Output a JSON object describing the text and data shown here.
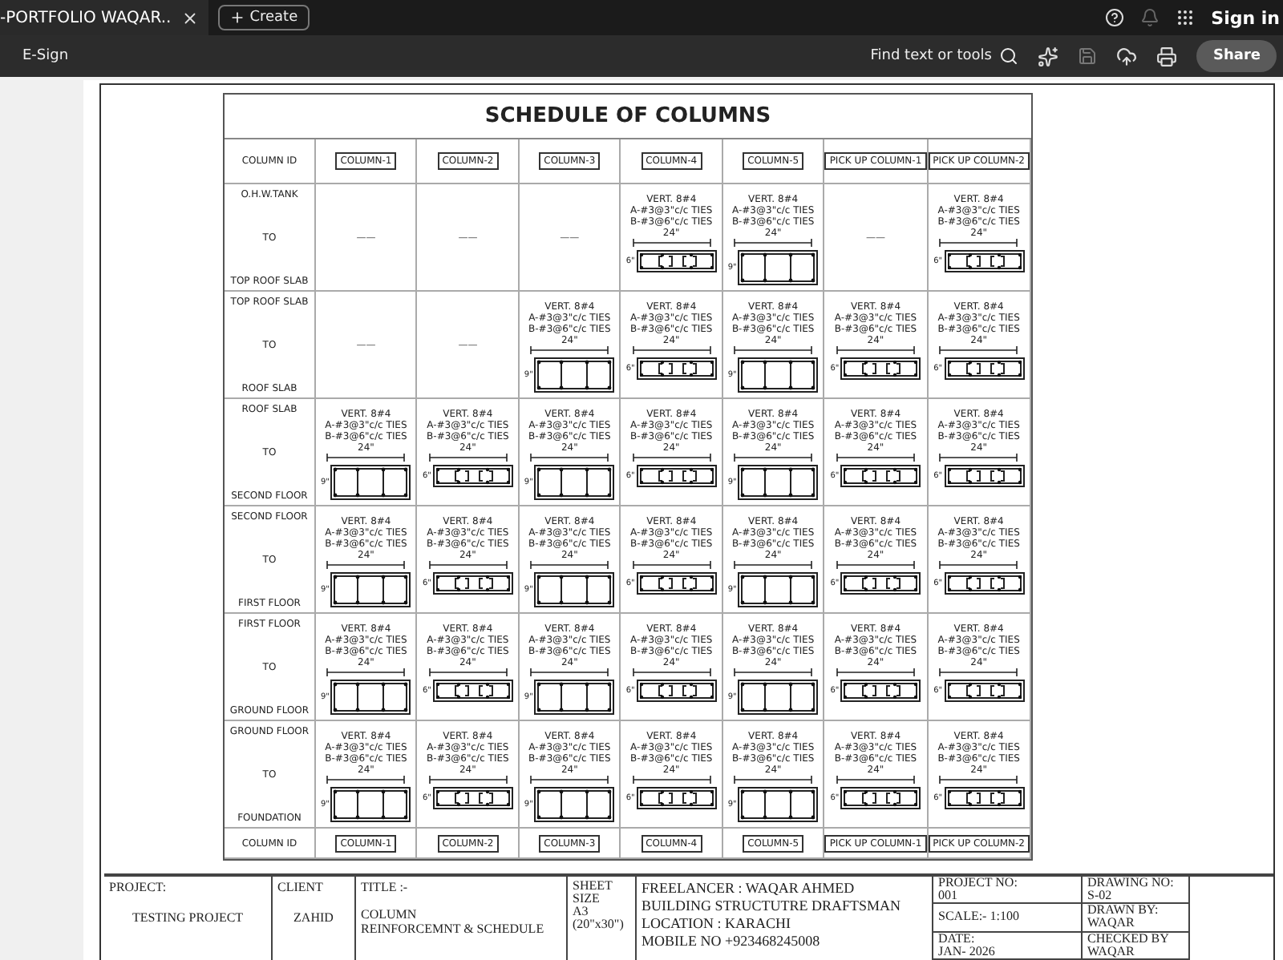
{
  "app_bar": {
    "tab_title": "-PORTFOLIO WAQAR..",
    "create": "Create",
    "sign_in": "Sign in"
  },
  "toolbar": {
    "esign": "E-Sign",
    "find": "Find text or tools",
    "share": "Share"
  },
  "schedule": {
    "title": "SCHEDULE OF COLUMNS",
    "id_label": "COLUMN ID",
    "columns": [
      "COLUMN-1",
      "COLUMN-2",
      "COLUMN-3",
      "COLUMN-4",
      "COLUMN-5",
      "PICK UP COLUMN-1",
      "PICK UP COLUMN-2"
    ],
    "rows": [
      {
        "from": "O.H.W.TANK",
        "mid": "TO",
        "to": "TOP ROOF SLAB",
        "cells": [
          {
            "kind": "empty",
            "text": "——"
          },
          {
            "kind": "empty",
            "text": "——"
          },
          {
            "kind": "empty",
            "text": "——"
          },
          {
            "kind": "thin",
            "vert": "VERT. 8#4",
            "tie_a": "A-#3@3\"c/c TIES",
            "tie_b": "B-#3@6\"c/c TIES",
            "width": "24\"",
            "depth": "6\""
          },
          {
            "kind": "tall",
            "vert": "VERT. 8#4",
            "tie_a": "A-#3@3\"c/c TIES",
            "tie_b": "B-#3@6\"c/c TIES",
            "width": "24\"",
            "depth": "9\""
          },
          {
            "kind": "empty",
            "text": "——"
          },
          {
            "kind": "thin",
            "vert": "VERT. 8#4",
            "tie_a": "A-#3@3\"c/c TIES",
            "tie_b": "B-#3@6\"c/c TIES",
            "width": "24\"",
            "depth": "6\""
          }
        ]
      },
      {
        "from": "TOP ROOF SLAB",
        "mid": "TO",
        "to": "ROOF SLAB",
        "cells": [
          {
            "kind": "empty",
            "text": "——"
          },
          {
            "kind": "empty",
            "text": "——"
          },
          {
            "kind": "tall",
            "vert": "VERT. 8#4",
            "tie_a": "A-#3@3\"c/c TIES",
            "tie_b": "B-#3@6\"c/c TIES",
            "width": "24\"",
            "depth": "9\""
          },
          {
            "kind": "thin",
            "vert": "VERT. 8#4",
            "tie_a": "A-#3@3\"c/c TIES",
            "tie_b": "B-#3@6\"c/c TIES",
            "width": "24\"",
            "depth": "6\""
          },
          {
            "kind": "tall",
            "vert": "VERT. 8#4",
            "tie_a": "A-#3@3\"c/c TIES",
            "tie_b": "B-#3@6\"c/c TIES",
            "width": "24\"",
            "depth": "9\""
          },
          {
            "kind": "thin",
            "vert": "VERT. 8#4",
            "tie_a": "A-#3@3\"c/c TIES",
            "tie_b": "B-#3@6\"c/c TIES",
            "width": "24\"",
            "depth": "6\""
          },
          {
            "kind": "thin",
            "vert": "VERT. 8#4",
            "tie_a": "A-#3@3\"c/c TIES",
            "tie_b": "B-#3@6\"c/c TIES",
            "width": "24\"",
            "depth": "6\""
          }
        ]
      },
      {
        "from": "ROOF SLAB",
        "mid": "TO",
        "to": "SECOND FLOOR",
        "cells": [
          {
            "kind": "tall",
            "vert": "VERT. 8#4",
            "tie_a": "A-#3@3\"c/c TIES",
            "tie_b": "B-#3@6\"c/c TIES",
            "width": "24\"",
            "depth": "9\""
          },
          {
            "kind": "thin",
            "vert": "VERT. 8#4",
            "tie_a": "A-#3@3\"c/c TIES",
            "tie_b": "B-#3@6\"c/c TIES",
            "width": "24\"",
            "depth": "6\""
          },
          {
            "kind": "tall",
            "vert": "VERT. 8#4",
            "tie_a": "A-#3@3\"c/c TIES",
            "tie_b": "B-#3@6\"c/c TIES",
            "width": "24\"",
            "depth": "9\""
          },
          {
            "kind": "thin",
            "vert": "VERT. 8#4",
            "tie_a": "A-#3@3\"c/c TIES",
            "tie_b": "B-#3@6\"c/c TIES",
            "width": "24\"",
            "depth": "6\""
          },
          {
            "kind": "tall",
            "vert": "VERT. 8#4",
            "tie_a": "A-#3@3\"c/c TIES",
            "tie_b": "B-#3@6\"c/c TIES",
            "width": "24\"",
            "depth": "9\""
          },
          {
            "kind": "thin",
            "vert": "VERT. 8#4",
            "tie_a": "A-#3@3\"c/c TIES",
            "tie_b": "B-#3@6\"c/c TIES",
            "width": "24\"",
            "depth": "6\""
          },
          {
            "kind": "thin",
            "vert": "VERT. 8#4",
            "tie_a": "A-#3@3\"c/c TIES",
            "tie_b": "B-#3@6\"c/c TIES",
            "width": "24\"",
            "depth": "6\""
          }
        ]
      },
      {
        "from": "SECOND FLOOR",
        "mid": "TO",
        "to": "FIRST FLOOR",
        "cells": [
          {
            "kind": "tall",
            "vert": "VERT. 8#4",
            "tie_a": "A-#3@3\"c/c TIES",
            "tie_b": "B-#3@6\"c/c TIES",
            "width": "24\"",
            "depth": "9\""
          },
          {
            "kind": "thin",
            "vert": "VERT. 8#4",
            "tie_a": "A-#3@3\"c/c TIES",
            "tie_b": "B-#3@6\"c/c TIES",
            "width": "24\"",
            "depth": "6\""
          },
          {
            "kind": "tall",
            "vert": "VERT. 8#4",
            "tie_a": "A-#3@3\"c/c TIES",
            "tie_b": "B-#3@6\"c/c TIES",
            "width": "24\"",
            "depth": "9\""
          },
          {
            "kind": "thin",
            "vert": "VERT. 8#4",
            "tie_a": "A-#3@3\"c/c TIES",
            "tie_b": "B-#3@6\"c/c TIES",
            "width": "24\"",
            "depth": "6\""
          },
          {
            "kind": "tall",
            "vert": "VERT. 8#4",
            "tie_a": "A-#3@3\"c/c TIES",
            "tie_b": "B-#3@6\"c/c TIES",
            "width": "24\"",
            "depth": "9\""
          },
          {
            "kind": "thin",
            "vert": "VERT. 8#4",
            "tie_a": "A-#3@3\"c/c TIES",
            "tie_b": "B-#3@6\"c/c TIES",
            "width": "24\"",
            "depth": "6\""
          },
          {
            "kind": "thin",
            "vert": "VERT. 8#4",
            "tie_a": "A-#3@3\"c/c TIES",
            "tie_b": "B-#3@6\"c/c TIES",
            "width": "24\"",
            "depth": "6\""
          }
        ]
      },
      {
        "from": "FIRST FLOOR",
        "mid": "TO",
        "to": "GROUND FLOOR",
        "cells": [
          {
            "kind": "tall",
            "vert": "VERT. 8#4",
            "tie_a": "A-#3@3\"c/c TIES",
            "tie_b": "B-#3@6\"c/c TIES",
            "width": "24\"",
            "depth": "9\""
          },
          {
            "kind": "thin",
            "vert": "VERT. 8#4",
            "tie_a": "A-#3@3\"c/c TIES",
            "tie_b": "B-#3@6\"c/c TIES",
            "width": "24\"",
            "depth": "6\""
          },
          {
            "kind": "tall",
            "vert": "VERT. 8#4",
            "tie_a": "A-#3@3\"c/c TIES",
            "tie_b": "B-#3@6\"c/c TIES",
            "width": "24\"",
            "depth": "9\""
          },
          {
            "kind": "thin",
            "vert": "VERT. 8#4",
            "tie_a": "A-#3@3\"c/c TIES",
            "tie_b": "B-#3@6\"c/c TIES",
            "width": "24\"",
            "depth": "6\""
          },
          {
            "kind": "tall",
            "vert": "VERT. 8#4",
            "tie_a": "A-#3@3\"c/c TIES",
            "tie_b": "B-#3@6\"c/c TIES",
            "width": "24\"",
            "depth": "9\""
          },
          {
            "kind": "thin",
            "vert": "VERT. 8#4",
            "tie_a": "A-#3@3\"c/c TIES",
            "tie_b": "B-#3@6\"c/c TIES",
            "width": "24\"",
            "depth": "6\""
          },
          {
            "kind": "thin",
            "vert": "VERT. 8#4",
            "tie_a": "A-#3@3\"c/c TIES",
            "tie_b": "B-#3@6\"c/c TIES",
            "width": "24\"",
            "depth": "6\""
          }
        ]
      },
      {
        "from": "GROUND FLOOR",
        "mid": "TO",
        "to": "FOUNDATION",
        "cells": [
          {
            "kind": "tall",
            "vert": "VERT. 8#4",
            "tie_a": "A-#3@3\"c/c TIES",
            "tie_b": "B-#3@6\"c/c TIES",
            "width": "24\"",
            "depth": "9\""
          },
          {
            "kind": "thin",
            "vert": "VERT. 8#4",
            "tie_a": "A-#3@3\"c/c TIES",
            "tie_b": "B-#3@6\"c/c TIES",
            "width": "24\"",
            "depth": "6\""
          },
          {
            "kind": "tall",
            "vert": "VERT. 8#4",
            "tie_a": "A-#3@3\"c/c TIES",
            "tie_b": "B-#3@6\"c/c TIES",
            "width": "24\"",
            "depth": "9\""
          },
          {
            "kind": "thin",
            "vert": "VERT. 8#4",
            "tie_a": "A-#3@3\"c/c TIES",
            "tie_b": "B-#3@6\"c/c TIES",
            "width": "24\"",
            "depth": "6\""
          },
          {
            "kind": "tall",
            "vert": "VERT. 8#4",
            "tie_a": "A-#3@3\"c/c TIES",
            "tie_b": "B-#3@6\"c/c TIES",
            "width": "24\"",
            "depth": "9\""
          },
          {
            "kind": "thin",
            "vert": "VERT. 8#4",
            "tie_a": "A-#3@3\"c/c TIES",
            "tie_b": "B-#3@6\"c/c TIES",
            "width": "24\"",
            "depth": "6\""
          },
          {
            "kind": "thin",
            "vert": "VERT. 8#4",
            "tie_a": "A-#3@3\"c/c TIES",
            "tie_b": "B-#3@6\"c/c TIES",
            "width": "24\"",
            "depth": "6\""
          }
        ]
      }
    ],
    "footer_label": "COLUMN ID",
    "footer_columns": [
      "COLUMN-1",
      "COLUMN-2",
      "COLUMN-3",
      "COLUMN-4",
      "COLUMN-5",
      "PICK UP COLUMN-1",
      "PICK UP COLUMN-2"
    ]
  },
  "title_block": {
    "project": {
      "label": "PROJECT:",
      "value": "TESTING PROJECT"
    },
    "client": {
      "label": "CLIENT",
      "value": "ZAHID"
    },
    "title": {
      "label": "TITLE :-",
      "lines": [
        "COLUMN",
        "REINFORCEMNT & SCHEDULE"
      ]
    },
    "sheet": [
      "SHEET",
      "SIZE",
      "A3",
      "(20\"x30\")"
    ],
    "freelancer": [
      "FREELANCER :  WAQAR AHMED",
      "BUILDING STRUCTUTRE DRAFTSMAN",
      "LOCATION : KARACHI",
      "MOBILE NO  +923468245008"
    ],
    "info": [
      {
        "label": "PROJECT NO:",
        "value": "001"
      },
      {
        "label": "SCALE:- 1:100"
      },
      {
        "label": "DATE:",
        "value": "JAN- 2026"
      }
    ],
    "drawing": [
      {
        "label": "DRAWING NO:",
        "value": "S-02"
      },
      {
        "label": "DRAWN BY:",
        "value": "WAQAR"
      },
      {
        "label": "CHECKED BY",
        "value": "WAQAR"
      }
    ]
  }
}
